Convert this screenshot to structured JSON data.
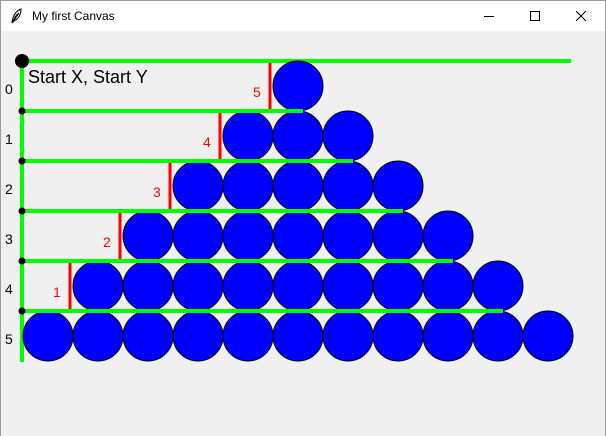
{
  "window": {
    "title": "My first Canvas",
    "icon": "feather-icon",
    "controls": [
      "minimize-icon",
      "maximize-icon",
      "close-icon"
    ]
  },
  "canvas": {
    "start_label": "Start X, Start Y",
    "row_labels": [
      "0",
      "1",
      "2",
      "3",
      "4",
      "5"
    ],
    "offset_labels": [
      "5",
      "4",
      "3",
      "2",
      "1"
    ],
    "pyramid_row_counts": [
      1,
      3,
      5,
      7,
      9,
      11
    ],
    "colors": {
      "circle_fill": "#0000ff",
      "circle_outline": "#000000",
      "guide_line": "#00ff00",
      "offset_marker": "#ff0000",
      "offset_text": "#ff0000",
      "row_label": "#000000",
      "background": "#f0f0f0"
    }
  }
}
